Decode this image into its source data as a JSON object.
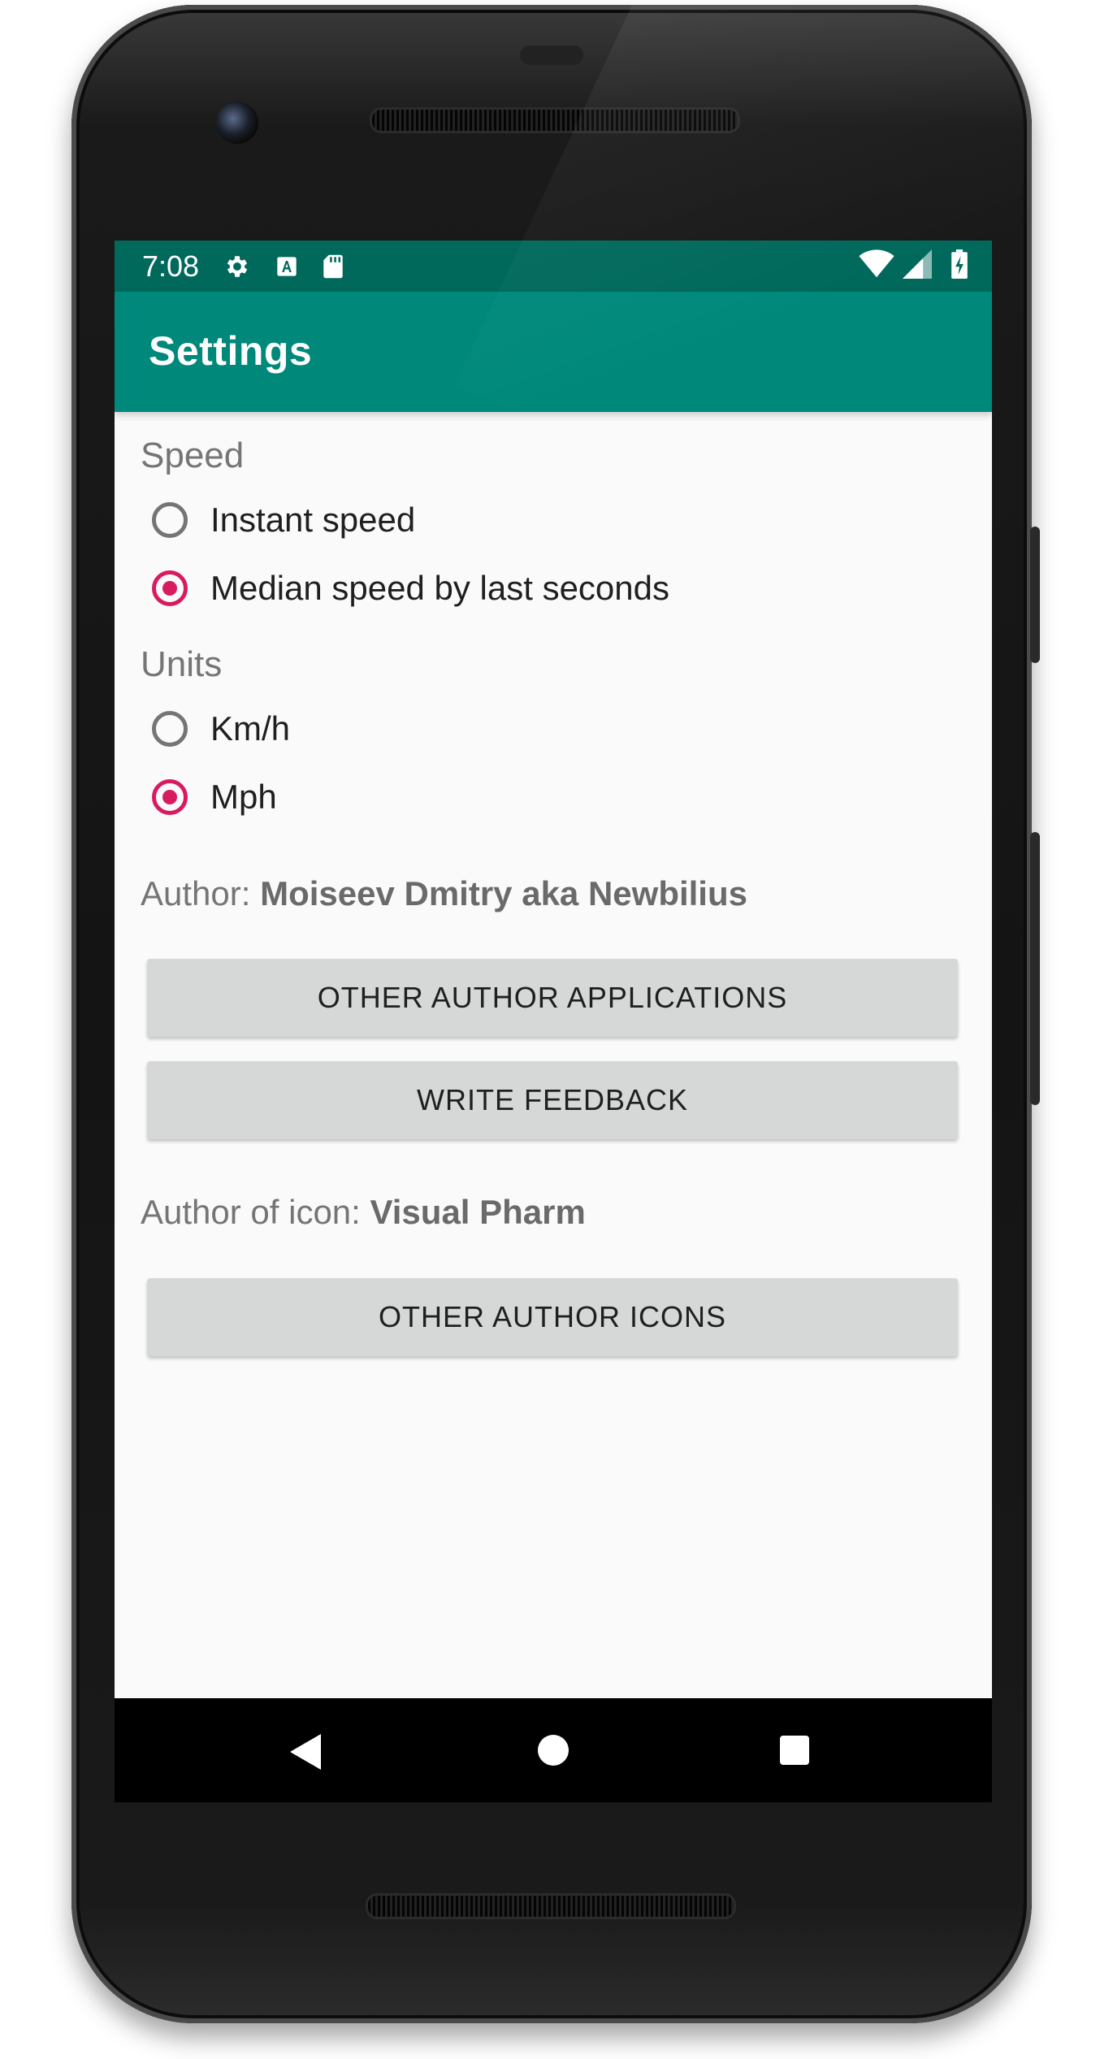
{
  "status_bar": {
    "time": "7:08",
    "left_icons": [
      "gear-icon",
      "a-letter-icon",
      "sd-card-icon"
    ],
    "right_icons": [
      "wifi-icon",
      "cell-signal-icon",
      "battery-charging-icon"
    ]
  },
  "app_bar": {
    "title": "Settings"
  },
  "speed": {
    "label": "Speed",
    "options": [
      {
        "label": "Instant speed",
        "checked": false
      },
      {
        "label": "Median speed by last seconds",
        "checked": true
      }
    ]
  },
  "units": {
    "label": "Units",
    "options": [
      {
        "label": "Km/h",
        "checked": false
      },
      {
        "label": "Mph",
        "checked": true
      }
    ]
  },
  "author": {
    "prefix": "Author: ",
    "name": "Moiseev Dmitry aka Newbilius",
    "apps_button": "OTHER AUTHOR APPLICATIONS",
    "feedback_button": "WRITE FEEDBACK"
  },
  "icon_author": {
    "prefix": "Author of icon: ",
    "name": "Visual Pharm",
    "icons_button": "OTHER AUTHOR ICONS"
  },
  "colors": {
    "status_bar": "#00695c",
    "app_bar": "#00897b",
    "accent": "#d81b60",
    "background": "#fafafa",
    "button": "#d6d7d7"
  }
}
